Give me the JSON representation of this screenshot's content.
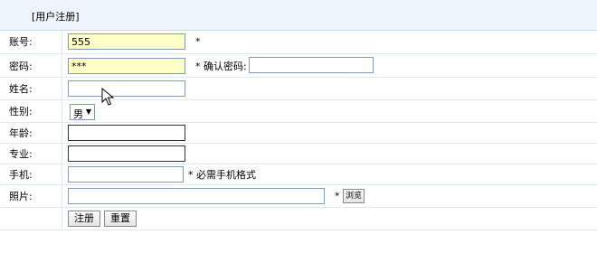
{
  "header": {
    "title": "[用户注册]"
  },
  "form": {
    "account": {
      "label": "账号:",
      "value": "555",
      "note": "*"
    },
    "password": {
      "label": "密码:",
      "value": "***",
      "note": "* 确认密码:"
    },
    "name": {
      "label": "姓名:",
      "value": ""
    },
    "gender": {
      "label": "性别:",
      "selected": "男"
    },
    "age": {
      "label": "年龄:",
      "value": ""
    },
    "major": {
      "label": "专业:",
      "value": ""
    },
    "phone": {
      "label": "手机:",
      "value": "",
      "note": "* 必需手机格式"
    },
    "photo": {
      "label": "照片:",
      "value": "",
      "note": "*",
      "browse_label": "浏览"
    },
    "buttons": {
      "register": "注册",
      "reset": "重置"
    }
  }
}
